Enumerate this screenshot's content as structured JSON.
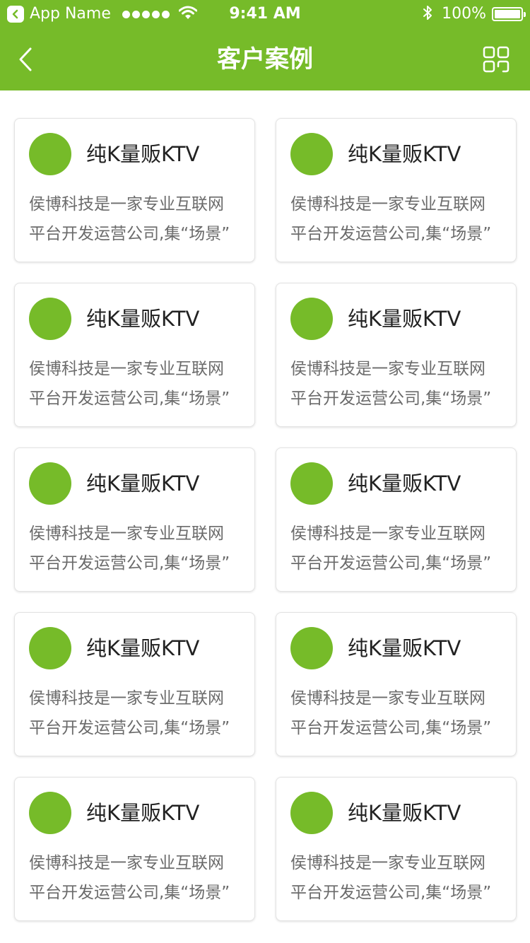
{
  "status_bar": {
    "carrier": "App Name",
    "time": "9:41 AM",
    "battery": "100%"
  },
  "nav": {
    "title": "客户案例"
  },
  "colors": {
    "brand": "#76bb29",
    "card_border": "#e3e3e3",
    "title_text": "#222222",
    "desc_text": "#6b6b6b"
  },
  "icons": {
    "back": "chevron-left-icon",
    "menu": "grid-icon"
  },
  "cases": [
    {
      "title": "纯K量贩KTV",
      "desc_line1": "侯博科技是一家专业互联网",
      "desc_line2": "平台开发运营公司,集“场景”"
    },
    {
      "title": "纯K量贩KTV",
      "desc_line1": "侯博科技是一家专业互联网",
      "desc_line2": "平台开发运营公司,集“场景”"
    },
    {
      "title": "纯K量贩KTV",
      "desc_line1": "侯博科技是一家专业互联网",
      "desc_line2": "平台开发运营公司,集“场景”"
    },
    {
      "title": "纯K量贩KTV",
      "desc_line1": "侯博科技是一家专业互联网",
      "desc_line2": "平台开发运营公司,集“场景”"
    },
    {
      "title": "纯K量贩KTV",
      "desc_line1": "侯博科技是一家专业互联网",
      "desc_line2": "平台开发运营公司,集“场景”"
    },
    {
      "title": "纯K量贩KTV",
      "desc_line1": "侯博科技是一家专业互联网",
      "desc_line2": "平台开发运营公司,集“场景”"
    },
    {
      "title": "纯K量贩KTV",
      "desc_line1": "侯博科技是一家专业互联网",
      "desc_line2": "平台开发运营公司,集“场景”"
    },
    {
      "title": "纯K量贩KTV",
      "desc_line1": "侯博科技是一家专业互联网",
      "desc_line2": "平台开发运营公司,集“场景”"
    },
    {
      "title": "纯K量贩KTV",
      "desc_line1": "侯博科技是一家专业互联网",
      "desc_line2": "平台开发运营公司,集“场景”"
    },
    {
      "title": "纯K量贩KTV",
      "desc_line1": "侯博科技是一家专业互联网",
      "desc_line2": "平台开发运营公司,集“场景”"
    }
  ]
}
